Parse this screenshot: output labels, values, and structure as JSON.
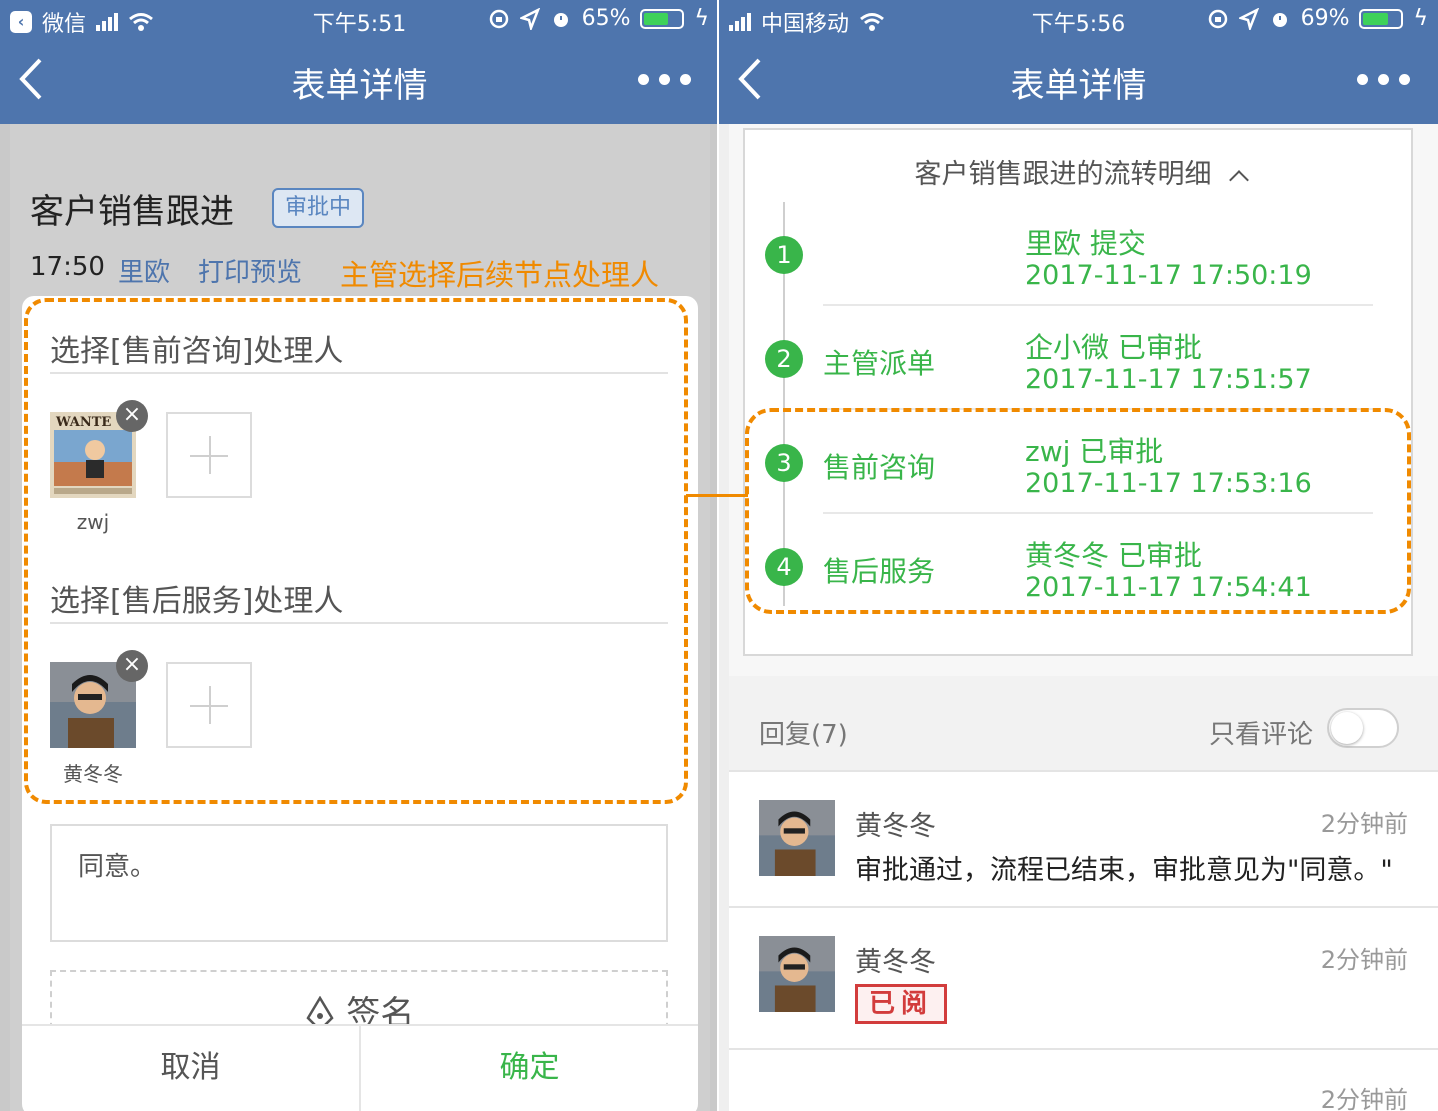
{
  "left": {
    "status": {
      "app": "微信",
      "time": "下午5:51",
      "battery": "65%",
      "battery_level": 0.65
    },
    "nav": {
      "title": "表单详情"
    },
    "form": {
      "title": "客户销售跟进",
      "badge": "审批中",
      "time": "17:50",
      "submitter": "里欧",
      "print_preview": "打印预览",
      "annotation": "主管选择后续节点处理人"
    },
    "sections": [
      {
        "title": "选择[售前咨询]处理人",
        "assignee": "zwj"
      },
      {
        "title": "选择[售后服务]处理人",
        "assignee": "黄冬冬"
      }
    ],
    "comment": "同意。",
    "signature": "签名",
    "footer": {
      "cancel": "取消",
      "confirm": "确定"
    }
  },
  "right": {
    "status": {
      "carrier": "中国移动",
      "time": "下午5:56",
      "battery": "69%",
      "battery_level": 0.69
    },
    "nav": {
      "title": "表单详情"
    },
    "flow": {
      "title": "客户销售跟进的流转明细",
      "steps": [
        {
          "num": "1",
          "name": "",
          "action": "里欧 提交",
          "time": "2017-11-17 17:50:19"
        },
        {
          "num": "2",
          "name": "主管派单",
          "action": "企小微 已审批",
          "time": "2017-11-17 17:51:57"
        },
        {
          "num": "3",
          "name": "售前咨询",
          "action": "zwj 已审批",
          "time": "2017-11-17 17:53:16"
        },
        {
          "num": "4",
          "name": "售后服务",
          "action": "黄冬冬 已审批",
          "time": "2017-11-17 17:54:41"
        }
      ]
    },
    "replies": {
      "label": "回复(7)",
      "only_comments": "只看评论",
      "only_comments_on": false,
      "items": [
        {
          "name": "黄冬冬",
          "time": "2分钟前",
          "text": "审批通过，流程已结束，审批意见为\"同意。\""
        },
        {
          "name": "黄冬冬",
          "time": "2分钟前",
          "stamp": "已阅"
        },
        {
          "time": "2分钟前"
        }
      ]
    }
  },
  "colors": {
    "nav": "#4e75ad",
    "green": "#39b54a",
    "orange": "#f08a00",
    "badge": "#5a86c0"
  }
}
